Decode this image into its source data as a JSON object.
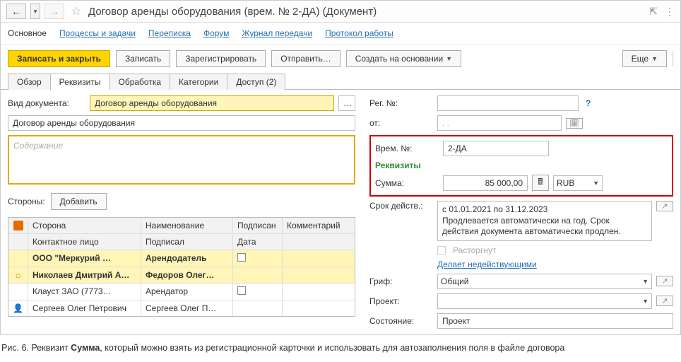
{
  "title": "Договор аренды оборудования (врем. № 2-ДА) (Документ)",
  "nav_links": {
    "main": "Основное",
    "processes": "Процессы и задачи",
    "correspondence": "Переписка",
    "forum": "Форум",
    "transfer_log": "Журнал передачи",
    "work_protocol": "Протокол работы"
  },
  "toolbar": {
    "write_close": "Записать и закрыть",
    "write": "Записать",
    "register": "Зарегистрировать",
    "send": "Отправить…",
    "create_based": "Создать на основании",
    "more": "Еще"
  },
  "tabs": {
    "review": "Обзор",
    "requisites": "Реквизиты",
    "processing": "Обработка",
    "categories": "Категории",
    "access": "Доступ (2)"
  },
  "left": {
    "doc_type_label": "Вид документа:",
    "doc_type_value": "Договор аренды оборудования",
    "name_value": "Договор аренды оборудования",
    "content_placeholder": "Содержание",
    "sides_label": "Стороны:",
    "add_btn": "Добавить",
    "columns": {
      "side": "Сторона",
      "name": "Наименование",
      "signed": "Подписан",
      "comment": "Комментарий",
      "contact": "Контактное лицо",
      "signed_by": "Подписал",
      "date": "Дата"
    },
    "rows": [
      {
        "side": "ООО \"Меркурий …",
        "name": "Арендодатель",
        "signed": false,
        "icon": "none",
        "bold": true
      },
      {
        "side": "Николаев Дмитрий А…",
        "name": "Федоров Олег…",
        "signed": null,
        "icon": "house",
        "bold": true
      },
      {
        "side": "Клауст ЗАО (7773…",
        "name": "Арендатор",
        "signed": false,
        "icon": "none",
        "bold": false
      },
      {
        "side": "Сергеев Олег Петрович",
        "name": "Сергеев Олег П…",
        "signed": null,
        "icon": "person",
        "bold": false
      }
    ]
  },
  "right": {
    "reg_no_label": "Рег. №:",
    "from_label": "от:",
    "from_value": ".   .",
    "temp_no_label": "Врем. №:",
    "temp_no_value": "2-ДА",
    "requisites_title": "Реквизиты",
    "amount_label": "Сумма:",
    "amount_value": "85 000,00",
    "currency": "RUB",
    "validity_label": "Срок действ.:",
    "validity_line1": "с 01.01.2021 по 31.12.2023",
    "validity_line2": "Продлевается автоматически на год. Срок действия документа автоматически продлен.",
    "terminated_label": "Расторгнут",
    "make_invalid": "Делает недействующими",
    "grif_label": "Гриф:",
    "grif_value": "Общий",
    "project_label": "Проект:",
    "state_label": "Состояние:",
    "state_value": "Проект"
  },
  "caption": {
    "prefix": "Рис. 6. Реквизит ",
    "bold": "Сумма",
    "suffix": ", который можно взять из регистрационной карточки и использовать для автозаполнения поля в файле договора"
  }
}
